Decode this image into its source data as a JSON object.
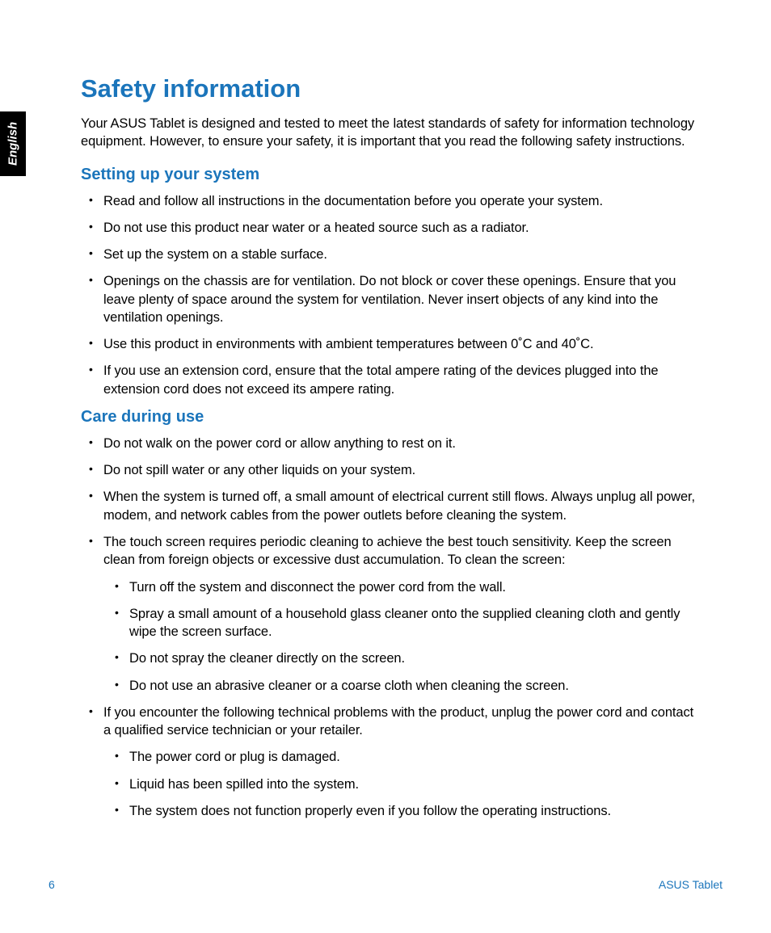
{
  "sideTab": "English",
  "title": "Safety information",
  "intro": "Your ASUS Tablet is designed and tested to meet the latest standards of safety for information technology equipment. However, to ensure your safety, it is important that you read the following safety instructions.",
  "section1": {
    "heading": "Setting up your system",
    "items": [
      "Read and follow all instructions in the documentation before you operate your system.",
      "Do not use this product near water or a heated source such as a radiator.",
      "Set up the system on a stable surface.",
      "Openings on the chassis are for ventilation. Do not block or cover these openings. Ensure that you leave plenty of space around the system for ventilation. Never insert objects of any kind into the ventilation openings.",
      "Use this product in environments with ambient temperatures between 0˚C and 40˚C.",
      "If you use an extension cord, ensure that the total ampere rating of the devices plugged into the extension cord does not exceed its ampere rating."
    ]
  },
  "section2": {
    "heading": "Care during use",
    "items": [
      {
        "text": "Do not walk on the power cord or allow anything to rest on it."
      },
      {
        "text": "Do not spill water or any other liquids on your system."
      },
      {
        "text": "When the system is turned off, a small amount of electrical current still flows. Always unplug all power, modem, and network cables from the power outlets before cleaning the system."
      },
      {
        "text": "The touch screen requires periodic cleaning to achieve the best touch sensitivity. Keep the screen clean from foreign objects or excessive dust accumulation. To clean the screen:",
        "sub": [
          "Turn off the system and disconnect the power cord from the wall.",
          "Spray a small amount of a household glass cleaner onto the supplied cleaning cloth and gently wipe the screen surface.",
          "Do not spray the cleaner directly on the screen.",
          "Do not use an abrasive cleaner or a coarse cloth when cleaning the screen."
        ]
      },
      {
        "text": "If you encounter the following technical problems with the product, unplug the power cord and contact a qualified service technician or your retailer.",
        "sub": [
          "The power cord or plug is damaged.",
          "Liquid has been spilled into the system.",
          "The system does not function properly even if you follow the operating instructions."
        ]
      }
    ]
  },
  "footer": {
    "pageNumber": "6",
    "docTitle": "ASUS Tablet"
  }
}
